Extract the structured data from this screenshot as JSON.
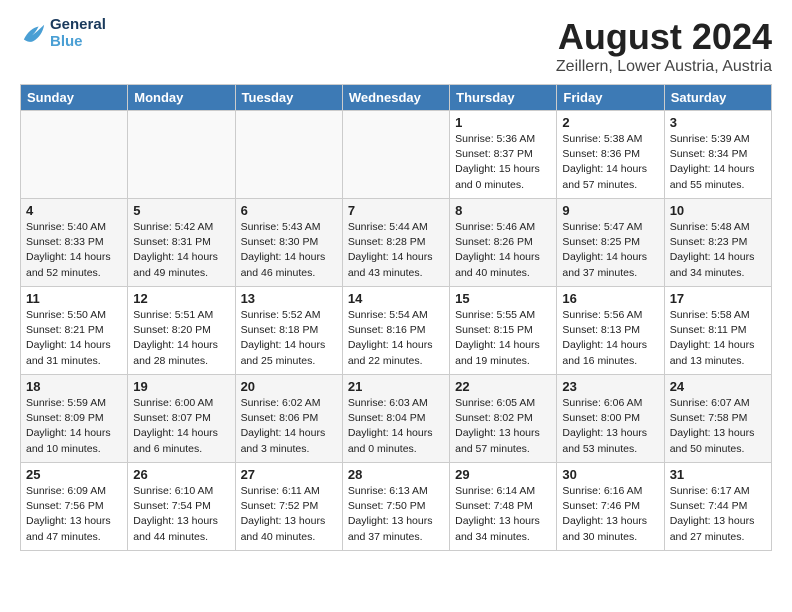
{
  "logo": {
    "line1": "General",
    "line2": "Blue"
  },
  "title": "August 2024",
  "subtitle": "Zeillern, Lower Austria, Austria",
  "weekdays": [
    "Sunday",
    "Monday",
    "Tuesday",
    "Wednesday",
    "Thursday",
    "Friday",
    "Saturday"
  ],
  "weeks": [
    [
      {
        "day": "",
        "content": ""
      },
      {
        "day": "",
        "content": ""
      },
      {
        "day": "",
        "content": ""
      },
      {
        "day": "",
        "content": ""
      },
      {
        "day": "1",
        "content": "Sunrise: 5:36 AM\nSunset: 8:37 PM\nDaylight: 15 hours\nand 0 minutes."
      },
      {
        "day": "2",
        "content": "Sunrise: 5:38 AM\nSunset: 8:36 PM\nDaylight: 14 hours\nand 57 minutes."
      },
      {
        "day": "3",
        "content": "Sunrise: 5:39 AM\nSunset: 8:34 PM\nDaylight: 14 hours\nand 55 minutes."
      }
    ],
    [
      {
        "day": "4",
        "content": "Sunrise: 5:40 AM\nSunset: 8:33 PM\nDaylight: 14 hours\nand 52 minutes."
      },
      {
        "day": "5",
        "content": "Sunrise: 5:42 AM\nSunset: 8:31 PM\nDaylight: 14 hours\nand 49 minutes."
      },
      {
        "day": "6",
        "content": "Sunrise: 5:43 AM\nSunset: 8:30 PM\nDaylight: 14 hours\nand 46 minutes."
      },
      {
        "day": "7",
        "content": "Sunrise: 5:44 AM\nSunset: 8:28 PM\nDaylight: 14 hours\nand 43 minutes."
      },
      {
        "day": "8",
        "content": "Sunrise: 5:46 AM\nSunset: 8:26 PM\nDaylight: 14 hours\nand 40 minutes."
      },
      {
        "day": "9",
        "content": "Sunrise: 5:47 AM\nSunset: 8:25 PM\nDaylight: 14 hours\nand 37 minutes."
      },
      {
        "day": "10",
        "content": "Sunrise: 5:48 AM\nSunset: 8:23 PM\nDaylight: 14 hours\nand 34 minutes."
      }
    ],
    [
      {
        "day": "11",
        "content": "Sunrise: 5:50 AM\nSunset: 8:21 PM\nDaylight: 14 hours\nand 31 minutes."
      },
      {
        "day": "12",
        "content": "Sunrise: 5:51 AM\nSunset: 8:20 PM\nDaylight: 14 hours\nand 28 minutes."
      },
      {
        "day": "13",
        "content": "Sunrise: 5:52 AM\nSunset: 8:18 PM\nDaylight: 14 hours\nand 25 minutes."
      },
      {
        "day": "14",
        "content": "Sunrise: 5:54 AM\nSunset: 8:16 PM\nDaylight: 14 hours\nand 22 minutes."
      },
      {
        "day": "15",
        "content": "Sunrise: 5:55 AM\nSunset: 8:15 PM\nDaylight: 14 hours\nand 19 minutes."
      },
      {
        "day": "16",
        "content": "Sunrise: 5:56 AM\nSunset: 8:13 PM\nDaylight: 14 hours\nand 16 minutes."
      },
      {
        "day": "17",
        "content": "Sunrise: 5:58 AM\nSunset: 8:11 PM\nDaylight: 14 hours\nand 13 minutes."
      }
    ],
    [
      {
        "day": "18",
        "content": "Sunrise: 5:59 AM\nSunset: 8:09 PM\nDaylight: 14 hours\nand 10 minutes."
      },
      {
        "day": "19",
        "content": "Sunrise: 6:00 AM\nSunset: 8:07 PM\nDaylight: 14 hours\nand 6 minutes."
      },
      {
        "day": "20",
        "content": "Sunrise: 6:02 AM\nSunset: 8:06 PM\nDaylight: 14 hours\nand 3 minutes."
      },
      {
        "day": "21",
        "content": "Sunrise: 6:03 AM\nSunset: 8:04 PM\nDaylight: 14 hours\nand 0 minutes."
      },
      {
        "day": "22",
        "content": "Sunrise: 6:05 AM\nSunset: 8:02 PM\nDaylight: 13 hours\nand 57 minutes."
      },
      {
        "day": "23",
        "content": "Sunrise: 6:06 AM\nSunset: 8:00 PM\nDaylight: 13 hours\nand 53 minutes."
      },
      {
        "day": "24",
        "content": "Sunrise: 6:07 AM\nSunset: 7:58 PM\nDaylight: 13 hours\nand 50 minutes."
      }
    ],
    [
      {
        "day": "25",
        "content": "Sunrise: 6:09 AM\nSunset: 7:56 PM\nDaylight: 13 hours\nand 47 minutes."
      },
      {
        "day": "26",
        "content": "Sunrise: 6:10 AM\nSunset: 7:54 PM\nDaylight: 13 hours\nand 44 minutes."
      },
      {
        "day": "27",
        "content": "Sunrise: 6:11 AM\nSunset: 7:52 PM\nDaylight: 13 hours\nand 40 minutes."
      },
      {
        "day": "28",
        "content": "Sunrise: 6:13 AM\nSunset: 7:50 PM\nDaylight: 13 hours\nand 37 minutes."
      },
      {
        "day": "29",
        "content": "Sunrise: 6:14 AM\nSunset: 7:48 PM\nDaylight: 13 hours\nand 34 minutes."
      },
      {
        "day": "30",
        "content": "Sunrise: 6:16 AM\nSunset: 7:46 PM\nDaylight: 13 hours\nand 30 minutes."
      },
      {
        "day": "31",
        "content": "Sunrise: 6:17 AM\nSunset: 7:44 PM\nDaylight: 13 hours\nand 27 minutes."
      }
    ]
  ]
}
